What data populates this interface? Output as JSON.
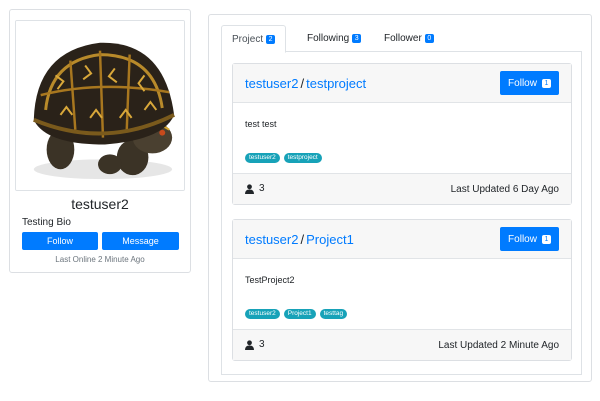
{
  "profile": {
    "username": "testuser2",
    "bio": "Testing Bio",
    "follow_label": "Follow",
    "message_label": "Message",
    "last_online": "Last Online 2 Minute Ago"
  },
  "tabs": [
    {
      "label": "Project",
      "count": "2"
    },
    {
      "label": "Following",
      "count": "3"
    },
    {
      "label": "Follower",
      "count": "0"
    }
  ],
  "projects": [
    {
      "owner": "testuser2",
      "separator": "/",
      "name": "testproject",
      "follow_label": "Follow",
      "follow_count": "1",
      "description": "test test",
      "tags": [
        "testuser2",
        "testproject"
      ],
      "members": "3",
      "last_updated": "Last Updated 6 Day Ago"
    },
    {
      "owner": "testuser2",
      "separator": "/",
      "name": "Project1",
      "follow_label": "Follow",
      "follow_count": "1",
      "description": "TestProject2",
      "tags": [
        "testuser2",
        "Project1",
        "testtag"
      ],
      "members": "3",
      "last_updated": "Last Updated 2 Minute Ago"
    }
  ],
  "colors": {
    "primary": "#007bff",
    "tag": "#17a2b8",
    "card_header": "#f7f7f7"
  }
}
